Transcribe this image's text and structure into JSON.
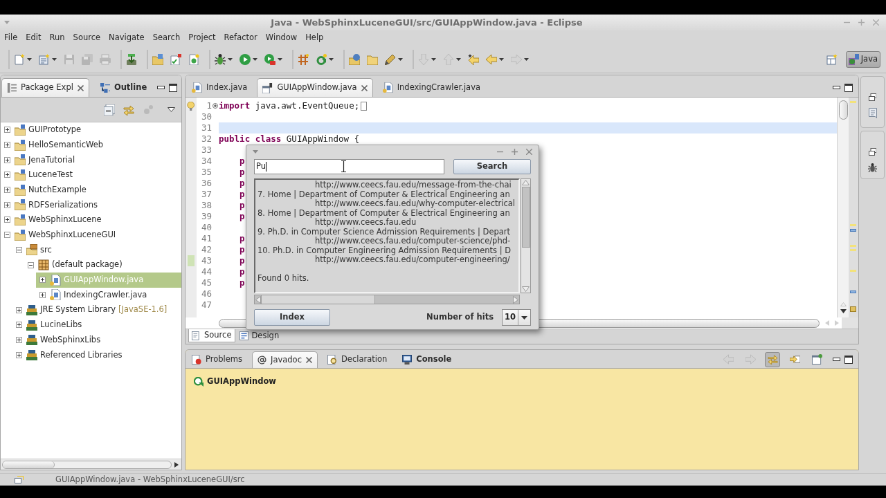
{
  "window": {
    "title": "Java - WebSphinxLuceneGUI/src/GUIAppWindow.java - Eclipse"
  },
  "menu": [
    "File",
    "Edit",
    "Run",
    "Source",
    "Navigate",
    "Search",
    "Project",
    "Refactor",
    "Window",
    "Help"
  ],
  "toolbar": [
    [
      {
        "disabled": false,
        "dropdown": true
      },
      {
        "disabled": false,
        "dropdown": true
      },
      {
        "disabled": true,
        "dropdown": false
      },
      {
        "disabled": true,
        "dropdown": false
      },
      {
        "disabled": true,
        "dropdown": false
      }
    ],
    [
      {
        "disabled": false,
        "dropdown": false
      }
    ],
    [
      {
        "disabled": false,
        "dropdown": false
      },
      {
        "disabled": false,
        "dropdown": false
      },
      {
        "disabled": false,
        "dropdown": false
      }
    ],
    [
      {
        "disabled": false,
        "dropdown": true
      },
      {
        "disabled": false,
        "dropdown": true
      },
      {
        "disabled": false,
        "dropdown": true
      }
    ],
    [
      {
        "disabled": false,
        "dropdown": false
      },
      {
        "disabled": false,
        "dropdown": true
      }
    ],
    [
      {
        "disabled": false,
        "dropdown": false
      },
      {
        "disabled": false,
        "dropdown": false
      },
      {
        "disabled": false,
        "dropdown": true
      }
    ],
    [
      {
        "disabled": true,
        "dropdown": true
      },
      {
        "disabled": true,
        "dropdown": true
      },
      {
        "disabled": false,
        "dropdown": false
      },
      {
        "disabled": false,
        "dropdown": true
      },
      {
        "disabled": true,
        "dropdown": true
      }
    ]
  ],
  "perspective": {
    "label": "Java",
    "selected": true
  },
  "package_explorer": {
    "tabs": [
      {
        "label": "Package Expl",
        "selected": true,
        "changed": false
      },
      {
        "label": "Outline",
        "selected": false,
        "changed": true
      }
    ],
    "toolbar": [
      {
        "disabled": false
      },
      {
        "disabled": false
      },
      {
        "disabled": true
      }
    ],
    "tree": [
      {
        "label": "GUIPrototype",
        "kind": "project",
        "expanded": false,
        "selected": false
      },
      {
        "label": "HelloSemanticWeb",
        "kind": "project",
        "expanded": false,
        "selected": false
      },
      {
        "label": "JenaTutorial",
        "kind": "project",
        "expanded": false,
        "selected": false
      },
      {
        "label": "LuceneTest",
        "kind": "project",
        "expanded": false,
        "selected": false
      },
      {
        "label": "NutchExample",
        "kind": "project",
        "expanded": false,
        "selected": false
      },
      {
        "label": "RDFSerializations",
        "kind": "project",
        "expanded": false,
        "selected": false
      },
      {
        "label": "WebSphinxLucene",
        "kind": "project",
        "expanded": false,
        "selected": false
      },
      {
        "label": "WebSphinxLuceneGUI",
        "kind": "project",
        "expanded": true,
        "selected": false,
        "children": [
          {
            "label": "src",
            "kind": "source_folder",
            "expanded": true,
            "selected": false,
            "children": [
              {
                "label": "(default package)",
                "kind": "package",
                "expanded": true,
                "selected": false,
                "children": [
                  {
                    "label": "GUIAppWindow.java",
                    "kind": "java_file",
                    "expanded": false,
                    "selected": true
                  },
                  {
                    "label": "IndexingCrawler.java",
                    "kind": "java_file",
                    "expanded": false,
                    "selected": false
                  }
                ]
              }
            ]
          },
          {
            "label": "JRE System Library",
            "suffix": "[JavaSE-1.6]",
            "kind": "library",
            "expanded": false,
            "selected": false
          },
          {
            "label": "LucineLibs",
            "kind": "library",
            "expanded": false,
            "selected": false
          },
          {
            "label": "WebSphinxLibs",
            "kind": "library",
            "expanded": false,
            "selected": false
          },
          {
            "label": "Referenced Libraries",
            "kind": "library",
            "expanded": false,
            "selected": false
          }
        ]
      }
    ]
  },
  "editor": {
    "tabs": [
      {
        "label": "Index.java",
        "kind": "java",
        "selected": false
      },
      {
        "label": "GUIAppWindow.java",
        "kind": "form",
        "selected": true
      },
      {
        "label": "IndexingCrawler.java",
        "kind": "java",
        "selected": false
      }
    ],
    "lines": [
      {
        "number": "1",
        "folded": true,
        "warning": true,
        "current": false,
        "changed": false,
        "code": [
          {
            "text": "import",
            "keyword": true
          },
          {
            "text": " java.awt.EventQueue;",
            "keyword": false
          }
        ]
      },
      {
        "number": "30",
        "folded": false,
        "warning": false,
        "current": false,
        "changed": false
      },
      {
        "number": "31",
        "folded": false,
        "warning": false,
        "current": true,
        "changed": false
      },
      {
        "number": "32",
        "folded": false,
        "warning": false,
        "current": false,
        "changed": false,
        "code": [
          {
            "text": "public class",
            "keyword": true
          },
          {
            "text": " GUIAppWindow {",
            "keyword": false
          }
        ]
      },
      {
        "number": "33",
        "folded": false,
        "warning": false,
        "current": false,
        "changed": false
      },
      {
        "number": "34",
        "folded": false,
        "warning": false,
        "current": false,
        "changed": false,
        "code": [
          {
            "text": "\tp",
            "keyword": true
          }
        ]
      },
      {
        "number": "35",
        "folded": false,
        "warning": false,
        "current": false,
        "changed": false,
        "code": [
          {
            "text": "\tp",
            "keyword": true
          }
        ]
      },
      {
        "number": "36",
        "folded": false,
        "warning": false,
        "current": false,
        "changed": false,
        "code": [
          {
            "text": "\tp",
            "keyword": true
          }
        ]
      },
      {
        "number": "37",
        "folded": false,
        "warning": false,
        "current": false,
        "changed": false,
        "code": [
          {
            "text": "\tp",
            "keyword": true
          }
        ]
      },
      {
        "number": "38",
        "folded": false,
        "warning": false,
        "current": false,
        "changed": false,
        "code": [
          {
            "text": "\tp",
            "keyword": true
          }
        ]
      },
      {
        "number": "39",
        "folded": false,
        "warning": false,
        "current": false,
        "changed": false,
        "code": [
          {
            "text": "\tp",
            "keyword": true
          }
        ]
      },
      {
        "number": "40",
        "folded": false,
        "warning": false,
        "current": false,
        "changed": false
      },
      {
        "number": "41",
        "folded": false,
        "warning": false,
        "current": false,
        "changed": false,
        "code": [
          {
            "text": "\tp",
            "keyword": true
          }
        ]
      },
      {
        "number": "42",
        "folded": false,
        "warning": false,
        "current": false,
        "changed": false,
        "code": [
          {
            "text": "\tp",
            "keyword": true
          }
        ]
      },
      {
        "number": "43",
        "folded": false,
        "warning": false,
        "current": false,
        "changed": true,
        "code": [
          {
            "text": "\tp",
            "keyword": true
          }
        ]
      },
      {
        "number": "44",
        "folded": false,
        "warning": false,
        "current": false,
        "changed": false,
        "code": [
          {
            "text": "\tp",
            "keyword": true
          }
        ]
      },
      {
        "number": "45",
        "folded": false,
        "warning": false,
        "current": false,
        "changed": false,
        "code": [
          {
            "text": "\tp",
            "keyword": true
          }
        ]
      },
      {
        "number": "46",
        "folded": false,
        "warning": false,
        "current": false,
        "changed": false
      },
      {
        "number": "47",
        "folded": false,
        "warning": false,
        "current": false,
        "changed": false
      }
    ],
    "view_tabs": [
      {
        "label": "Source",
        "selected": true
      },
      {
        "label": "Design",
        "selected": false
      }
    ]
  },
  "bottom_panel": {
    "tabs": [
      {
        "label": "Problems",
        "kind": "problems",
        "selected": false,
        "changed": false
      },
      {
        "label": "Javadoc",
        "kind": "javadoc",
        "selected": true,
        "changed": false
      },
      {
        "label": "Declaration",
        "kind": "declaration",
        "selected": false,
        "changed": false
      },
      {
        "label": "Console",
        "kind": "console",
        "selected": false,
        "changed": true
      }
    ],
    "toolbar": [
      {
        "disabled": true,
        "selected": false
      },
      {
        "disabled": true,
        "selected": false
      },
      {
        "disabled": false,
        "selected": true
      },
      {
        "disabled": false,
        "selected": false
      },
      {
        "disabled": false,
        "selected": false
      }
    ],
    "javadoc": {
      "title": "GUIAppWindow"
    }
  },
  "status_bar": {
    "text": "GUIAppWindow.java - WebSphinxLuceneGUI/src"
  },
  "dialog": {
    "search": {
      "value": "Pu"
    },
    "search_button": "Search",
    "results": [
      {
        "kind": "url",
        "text": "http://www.ceecs.fau.edu/message-from-the-chai"
      },
      {
        "kind": "title",
        "text": "7. Home | Department of Computer & Electrical Engineering an"
      },
      {
        "kind": "url",
        "text": "http://www.ceecs.fau.edu/why-computer-electrical"
      },
      {
        "kind": "title",
        "text": "8. Home | Department of Computer & Electrical Engineering an"
      },
      {
        "kind": "url",
        "text": "http://www.ceecs.fau.edu"
      },
      {
        "kind": "title",
        "text": "9. Ph.D. in Computer Science Admission Requirements | Depart"
      },
      {
        "kind": "url",
        "text": "http://www.ceecs.fau.edu/computer-science/phd-"
      },
      {
        "kind": "title",
        "text": "10. Ph.D. in Computer Engineering Admission Requirements | D"
      },
      {
        "kind": "url",
        "text": "http://www.ceecs.fau.edu/computer-engineering/"
      },
      {
        "kind": "status",
        "text": "Found 0 hits."
      }
    ],
    "index_button": "Index",
    "hits_label": "Number of hits",
    "hits": {
      "value": "10"
    }
  }
}
